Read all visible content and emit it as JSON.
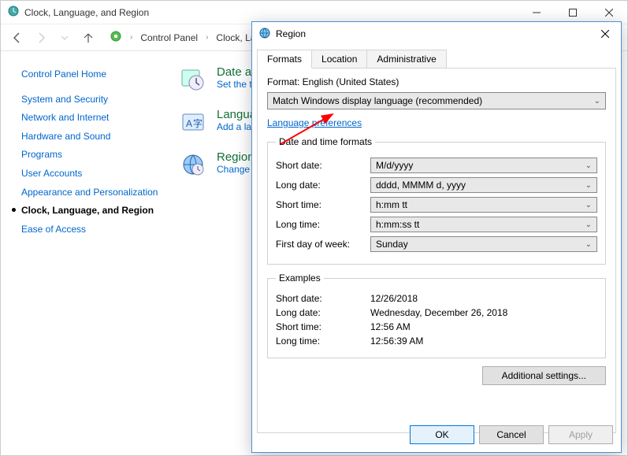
{
  "parent_window": {
    "title": "Clock, Language, and Region",
    "breadcrumb": [
      "Control Panel",
      "Clock, Langu"
    ]
  },
  "sidebar": {
    "header": "Control Panel Home",
    "items": [
      {
        "label": "System and Security"
      },
      {
        "label": "Network and Internet"
      },
      {
        "label": "Hardware and Sound"
      },
      {
        "label": "Programs"
      },
      {
        "label": "User Accounts"
      },
      {
        "label": "Appearance and Personalization"
      },
      {
        "label": "Clock, Language, and Region",
        "current": true
      },
      {
        "label": "Ease of Access"
      }
    ]
  },
  "main_categories": [
    {
      "title": "Date a",
      "link": "Set the ti",
      "icon": "datetime"
    },
    {
      "title": "Langua",
      "link": "Add a lan",
      "icon": "language"
    },
    {
      "title": "Region",
      "link": "Change l",
      "icon": "region"
    }
  ],
  "region_dialog": {
    "title": "Region",
    "tabs": [
      "Formats",
      "Location",
      "Administrative"
    ],
    "active_tab": "Formats",
    "format_label": "Format: English (United States)",
    "format_dropdown": "Match Windows display language (recommended)",
    "link_preferences": "Language preferences",
    "dtf_legend": "Date and time formats",
    "rows": {
      "short_date": {
        "label": "Short date:",
        "value": "M/d/yyyy"
      },
      "long_date": {
        "label": "Long date:",
        "value": "dddd, MMMM d, yyyy"
      },
      "short_time": {
        "label": "Short time:",
        "value": "h:mm tt"
      },
      "long_time": {
        "label": "Long time:",
        "value": "h:mm:ss tt"
      },
      "first_day": {
        "label": "First day of week:",
        "value": "Sunday"
      }
    },
    "examples_legend": "Examples",
    "examples": {
      "short_date": {
        "label": "Short date:",
        "value": "12/26/2018"
      },
      "long_date": {
        "label": "Long date:",
        "value": "Wednesday, December 26, 2018"
      },
      "short_time": {
        "label": "Short time:",
        "value": "12:56 AM"
      },
      "long_time": {
        "label": "Long time:",
        "value": "12:56:39 AM"
      }
    },
    "additional_settings": "Additional settings...",
    "buttons": {
      "ok": "OK",
      "cancel": "Cancel",
      "apply": "Apply"
    }
  }
}
